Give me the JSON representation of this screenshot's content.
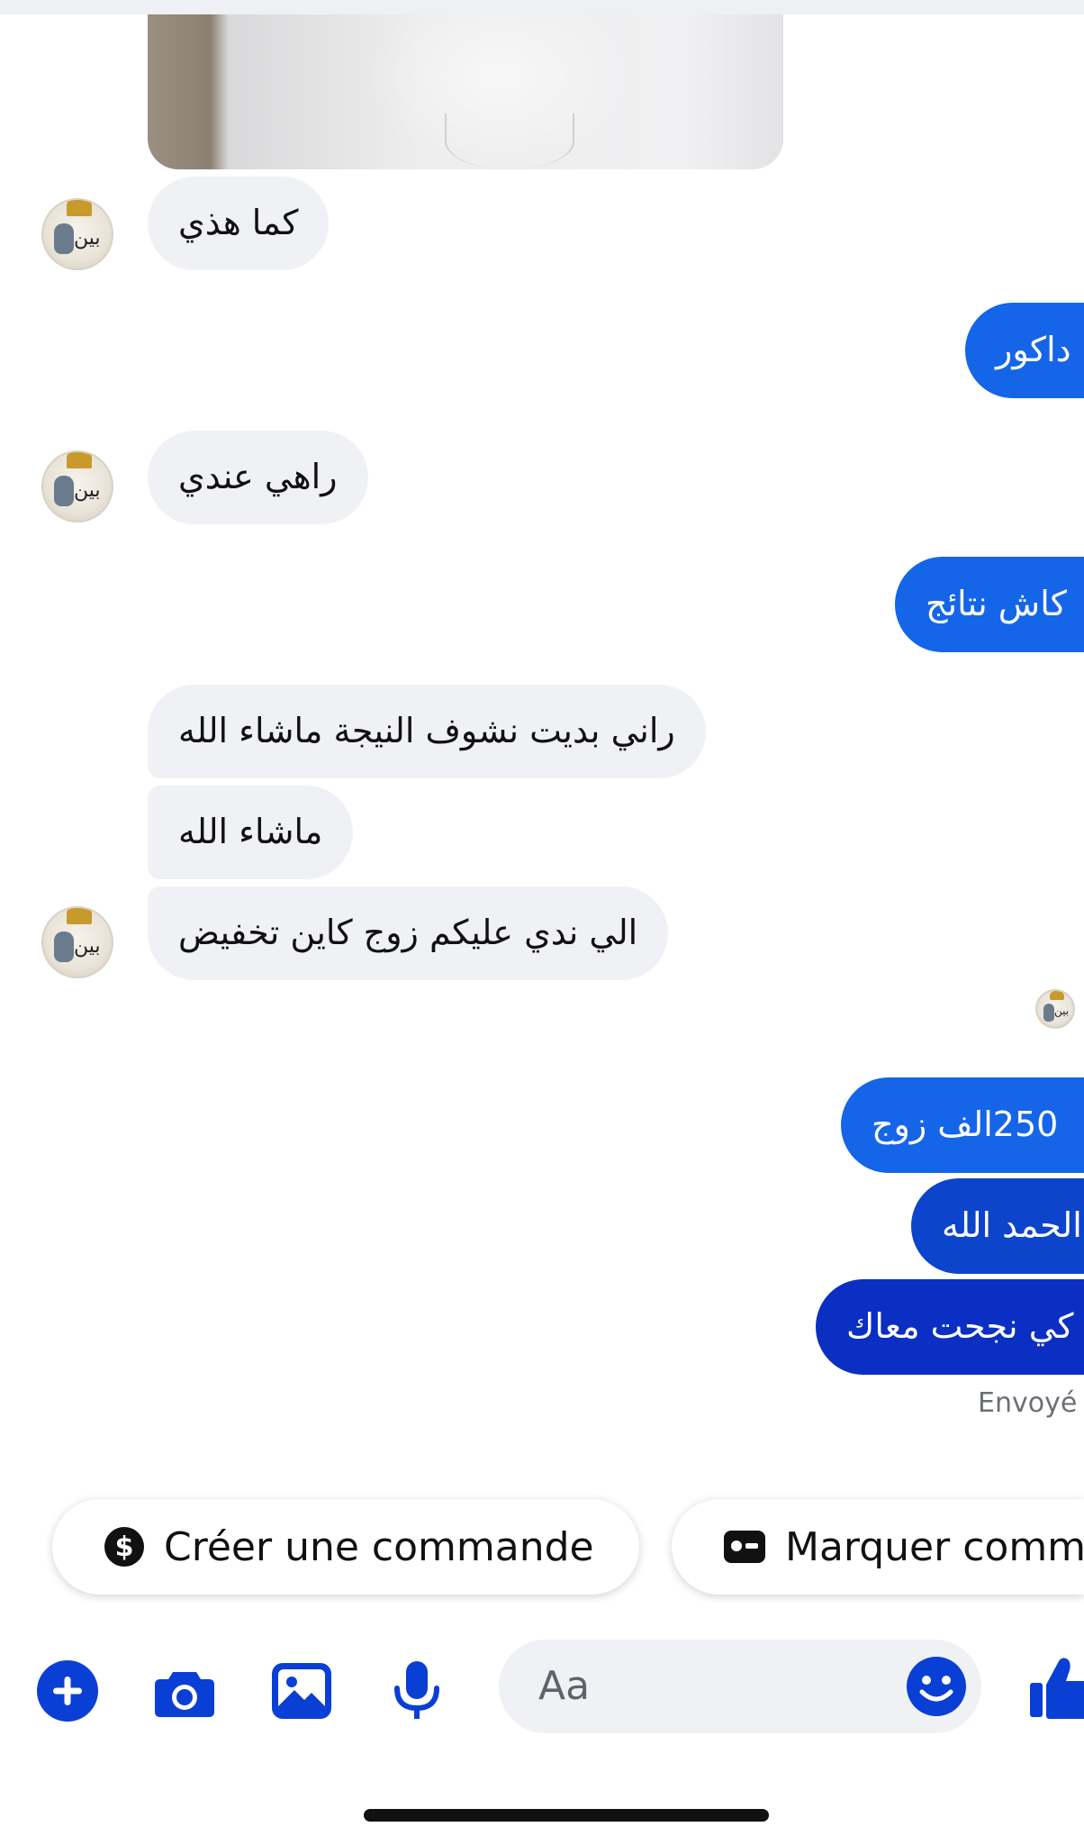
{
  "conversation": {
    "incoming": [
      {
        "text": "كما هذي"
      },
      {
        "text": "راهي عندي"
      },
      {
        "text": "راني بديت نشوف النيجة ماشاء الله"
      },
      {
        "text": "ماشاء الله"
      },
      {
        "text": "الي ندي عليكم زوج كاين تخفيض"
      }
    ],
    "outgoing": [
      {
        "text": "داكور"
      },
      {
        "text": "كاش نتائج"
      },
      {
        "text": "250الف زوج"
      },
      {
        "text": "الحمد الله"
      },
      {
        "text": "كي نجحت معاك"
      }
    ],
    "status": "Envoyé"
  },
  "actions": {
    "create_order": "Créer une commande",
    "mark_as": "Marquer comm"
  },
  "composer": {
    "placeholder": "Aa",
    "icons": [
      "plus-icon",
      "camera-icon",
      "gallery-icon",
      "microphone-icon",
      "emoji-icon",
      "thumbs-up-icon"
    ]
  },
  "colors": {
    "incoming_bubble": "#f0f1f4",
    "outgoing_1": "#1565e8",
    "outgoing_2": "#0d44cc",
    "outgoing_3": "#0b2fc2",
    "toolbar_blue": "#0a3fd6"
  }
}
